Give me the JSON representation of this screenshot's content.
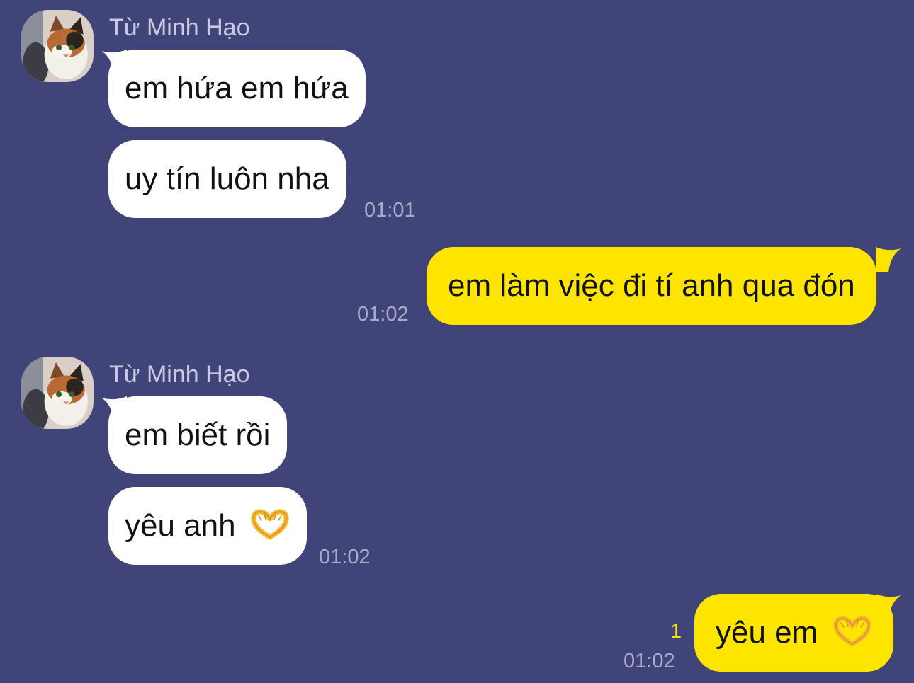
{
  "chat": {
    "contact_name": "Từ Minh Hạo",
    "avatar_icon": "cat-avatar-icon",
    "colors": {
      "background": "#404478",
      "incoming_bubble": "#ffffff",
      "outgoing_bubble": "#fee500",
      "timestamp": "#a9abca",
      "unread_count": "#fee500"
    },
    "groups": [
      {
        "direction": "incoming",
        "sender": "Từ Minh Hạo",
        "messages": [
          "em hứa em hứa",
          "uy tín luôn nha"
        ],
        "time": "01:01"
      },
      {
        "direction": "outgoing",
        "messages": [
          "em làm việc đi tí anh qua đón"
        ],
        "time": "01:02"
      },
      {
        "direction": "incoming",
        "sender": "Từ Minh Hạo",
        "messages": [
          "em biết rồi",
          "yêu anh"
        ],
        "emoji": "heart-hands-emoji",
        "time": "01:02"
      },
      {
        "direction": "outgoing",
        "messages": [
          "yêu em"
        ],
        "emoji": "heart-hands-emoji",
        "unread": "1",
        "time": "01:02"
      }
    ]
  }
}
